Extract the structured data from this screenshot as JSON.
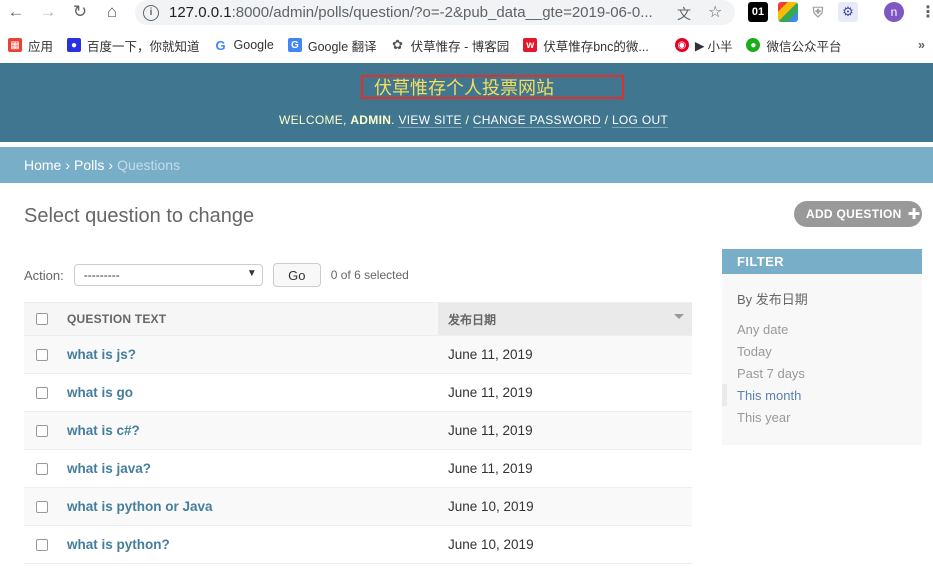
{
  "browser": {
    "url_host": "127.0.0.1",
    "url_path": ":8000/admin/polls/question/?o=-2&pub_data__gte=2019-06-0...",
    "avatar_letter": "n",
    "ext_01": "01"
  },
  "bookmarks": [
    {
      "label": "应用",
      "icon": "apps-icon",
      "color": "#e94235"
    },
    {
      "label": "百度一下，你就知道",
      "icon": "baidu-icon",
      "color": "#2932e1"
    },
    {
      "label": "Google",
      "icon": "google-icon",
      "color": "#4285f4"
    },
    {
      "label": "Google 翻译",
      "icon": "translate-icon",
      "color": "#4285f4"
    },
    {
      "label": "伏草惟存 - 博客园",
      "icon": "cnblogs-icon",
      "color": "#555555"
    },
    {
      "label": "伏草惟存bnc的微...",
      "icon": "weibo-icon",
      "color": "#e6162d"
    },
    {
      "label": "小半",
      "icon": "netease-icon",
      "color": "#e60026"
    },
    {
      "label": "微信公众平台",
      "icon": "wechat-icon",
      "color": "#1aad19"
    }
  ],
  "header": {
    "site_title": "伏草惟存个人投票网站",
    "welcome": "WELCOME,",
    "username": "ADMIN",
    "view_site": "VIEW SITE",
    "change_password": "CHANGE PASSWORD",
    "log_out": "LOG OUT"
  },
  "breadcrumbs": {
    "home": "Home",
    "app": "Polls",
    "current": "Questions",
    "separator": "›"
  },
  "content": {
    "title": "Select question to change",
    "add_button": "ADD QUESTION",
    "action_label": "Action:",
    "action_selected": "---------",
    "go_button": "Go",
    "selected_count": "0 of 6 selected"
  },
  "table": {
    "headers": {
      "question": "QUESTION TEXT",
      "date": "发布日期"
    },
    "rows": [
      {
        "question": "what is js?",
        "date": "June 11, 2019"
      },
      {
        "question": "what is go",
        "date": "June 11, 2019"
      },
      {
        "question": "what is c#?",
        "date": "June 11, 2019"
      },
      {
        "question": "what is java?",
        "date": "June 11, 2019"
      },
      {
        "question": "what is python or Java",
        "date": "June 10, 2019"
      },
      {
        "question": "what is python?",
        "date": "June 10, 2019"
      }
    ]
  },
  "filter": {
    "title": "FILTER",
    "subtitle": "By 发布日期",
    "options": [
      "Any date",
      "Today",
      "Past 7 days",
      "This month",
      "This year"
    ],
    "selected": "This month"
  },
  "colors": {
    "header_bg": "#417690",
    "breadcrumb_bg": "#79aec8",
    "title_text": "#f5dd5d",
    "highlight_box": "#e0302c",
    "link": "#447e9b"
  }
}
